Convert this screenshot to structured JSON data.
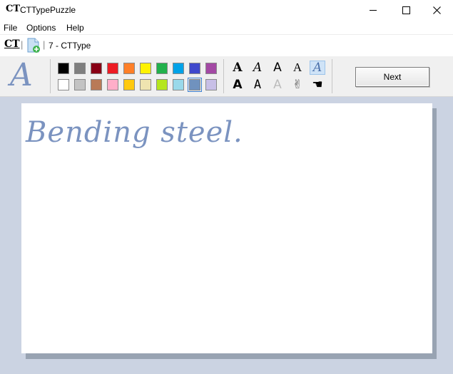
{
  "window": {
    "app_icon_text": "CT",
    "title": "CTTypePuzzle",
    "minimize_glyph": "—",
    "maximize_glyph": "☐",
    "close_glyph": "✕"
  },
  "menu": {
    "items": [
      "File",
      "Options",
      "Help"
    ]
  },
  "addressbar": {
    "root_icon_text": "CT",
    "separator": "|",
    "document_label": "7 - CTType"
  },
  "toolbar": {
    "font_preview_glyph": "A",
    "colors_row1": [
      "#000000",
      "#7f7f7f",
      "#880015",
      "#ed1c24",
      "#ff7f27",
      "#fff200",
      "#22b14c",
      "#00a2e8",
      "#3f48cc",
      "#a349a4"
    ],
    "colors_row2": [
      "#ffffff",
      "#c3c3c3",
      "#b97a57",
      "#ffaec9",
      "#ffc90e",
      "#efe4b0",
      "#b5e61d",
      "#99d9ea",
      "#7092be",
      "#c8bfe7"
    ],
    "selected_color": "#7092be",
    "font_buttons_row1": [
      "A",
      "A",
      "A",
      "A",
      "A"
    ],
    "font_buttons_row2": [
      "A",
      "A",
      "A",
      "✌",
      "☚"
    ],
    "selected_font_index": 4,
    "next_label": "Next"
  },
  "puzzle": {
    "text": "Bending steel.",
    "color": "#7b93c0"
  }
}
